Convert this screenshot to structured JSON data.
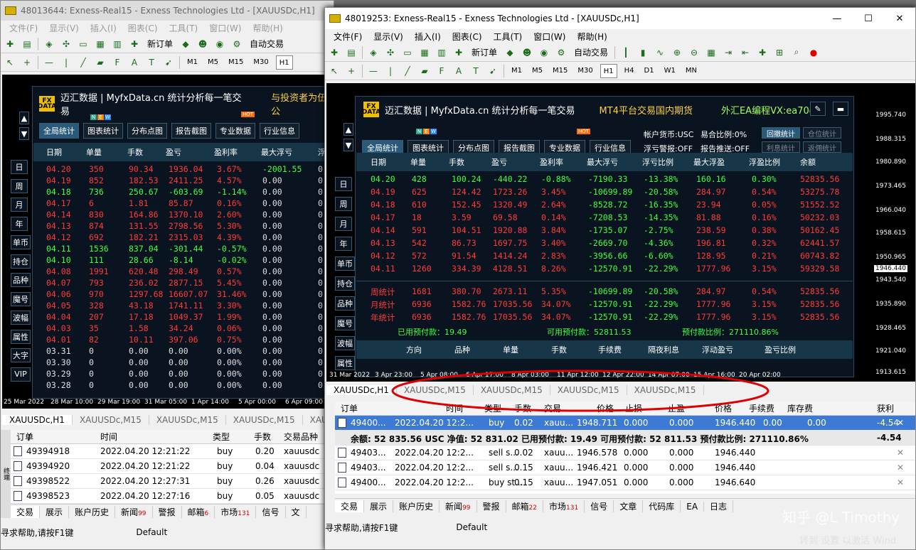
{
  "win1": {
    "title": "48013644: Exness-Real15 - Exness Technologies Ltd - [XAUUSDc,H1]",
    "menu": [
      "文件(F)",
      "显示(V)",
      "插入(I)",
      "图表(C)",
      "工具(T)",
      "窗口(W)",
      "帮助(H)"
    ],
    "new_order": "新订单",
    "auto": "自动交易",
    "tfs": [
      "M1",
      "M5",
      "M15",
      "M30",
      "H1"
    ],
    "brand": "迈汇数据 | MyfxData.cn  统计分析每一笔交易",
    "slogan": "与投资者为伍公",
    "buttons": [
      "全局统计",
      "图表统计",
      "分布点图",
      "报告截图",
      "专业数据",
      "行业信息"
    ],
    "headers": [
      "日期",
      "单量",
      "手数",
      "盈亏",
      "盈利率",
      "最大浮亏",
      "浮"
    ],
    "side": [
      "日",
      "周",
      "月",
      "年",
      "单币",
      "持仓",
      "品种",
      "魔号",
      "波幅",
      "属性",
      "大字",
      "VIP"
    ],
    "rows": [
      [
        "04.20",
        "350",
        "90.34",
        "1936.04",
        "3.67%",
        "-2001.55",
        "0.00",
        "r"
      ],
      [
        "04.19",
        "852",
        "182.53",
        "2411.25",
        "4.57%",
        "0.00",
        "0.00",
        "r"
      ],
      [
        "04.18",
        "736",
        "250.67",
        "-603.69",
        "-1.14%",
        "0.00",
        "0.00",
        "g"
      ],
      [
        "04.17",
        "6",
        "1.81",
        "85.87",
        "0.16%",
        "0.00",
        "0.00",
        "r"
      ],
      [
        "04.14",
        "830",
        "164.86",
        "1370.10",
        "2.60%",
        "0.00",
        "0.00",
        "r"
      ],
      [
        "04.13",
        "874",
        "131.55",
        "2798.56",
        "5.30%",
        "0.00",
        "0.00",
        "r"
      ],
      [
        "04.12",
        "692",
        "182.21",
        "2315.03",
        "4.39%",
        "0.00",
        "0.00",
        "r"
      ],
      [
        "04.11",
        "1536",
        "837.04",
        "-301.44",
        "-0.57%",
        "0.00",
        "0.00",
        "g"
      ],
      [
        "04.10",
        "111",
        "28.66",
        "-8.14",
        "-0.02%",
        "0.00",
        "0.00",
        "g"
      ],
      [
        "04.08",
        "1991",
        "620.48",
        "298.49",
        "0.57%",
        "0.00",
        "0.00",
        "r"
      ],
      [
        "04.07",
        "793",
        "236.02",
        "2877.15",
        "5.45%",
        "0.00",
        "0.00",
        "r"
      ],
      [
        "04.06",
        "970",
        "1297.68",
        "16607.07",
        "31.46%",
        "0.00",
        "0.00",
        "r"
      ],
      [
        "04.05",
        "328",
        "43.18",
        "1741.11",
        "3.30%",
        "0.00",
        "0.00",
        "r"
      ],
      [
        "04.04",
        "207",
        "17.18",
        "1049.37",
        "1.99%",
        "0.00",
        "0.00",
        "r"
      ],
      [
        "04.03",
        "35",
        "1.58",
        "34.24",
        "0.06%",
        "0.00",
        "0.00",
        "r"
      ],
      [
        "04.01",
        "82",
        "10.11",
        "397.06",
        "0.75%",
        "0.00",
        "0.00",
        "r"
      ],
      [
        "03.31",
        "0",
        "0.00",
        "0.00",
        "0.00%",
        "0.00",
        "0.00",
        "w"
      ],
      [
        "03.30",
        "0",
        "0.00",
        "0.00",
        "0.00%",
        "0.00",
        "0.00",
        "w"
      ],
      [
        "03.29",
        "0",
        "0.00",
        "0.00",
        "0.00%",
        "0.00",
        "0.00",
        "w"
      ],
      [
        "03.28",
        "0",
        "0.00",
        "0.00",
        "0.00%",
        "0.00",
        "0.00",
        "w"
      ]
    ],
    "xaxis": [
      "25 Mar 2022",
      "28 Mar 10:00",
      "29 Mar 19:00",
      "31 Mar 05:00",
      "1 Apr 14:00",
      "5 Apr 00:00",
      "6 Apr 09:00"
    ],
    "tabs": [
      "XAUUSDc,H1",
      "XAUUSDc,M15",
      "XAUUSDc,M15",
      "XAUUSDc,M15",
      "XAUU"
    ],
    "term_headers": [
      "订单",
      "/",
      "时间",
      "类型",
      "手数",
      "交易品种"
    ],
    "trades": [
      [
        "49394918",
        "2022.04.20 12:21:22",
        "buy",
        "0.20",
        "xauusdc"
      ],
      [
        "49394920",
        "2022.04.20 12:21:22",
        "buy",
        "0.04",
        "xauusdc"
      ],
      [
        "49398522",
        "2022.04.20 12:27:31",
        "buy",
        "0.26",
        "xauusdc"
      ],
      [
        "49398523",
        "2022.04.20 12:27:16",
        "buy",
        "0.05",
        "xauusdc"
      ]
    ],
    "btabs": [
      [
        "交易",
        ""
      ],
      [
        "展示",
        ""
      ],
      [
        "账户历史",
        ""
      ],
      [
        "新闻",
        "99"
      ],
      [
        "警报",
        ""
      ],
      [
        "邮箱",
        "6"
      ],
      [
        "市场",
        "131"
      ],
      [
        "信号",
        ""
      ],
      [
        "文",
        ""
      ]
    ],
    "status": "寻求帮助,请按F1键",
    "status2": "Default",
    "side_label": "终端"
  },
  "win2": {
    "title": "48019253: Exness-Real15 - Exness Technologies Ltd - [XAUUSDc,H1]",
    "menu": [
      "文件(F)",
      "显示(V)",
      "插入(I)",
      "图表(C)",
      "工具(T)",
      "窗口(W)",
      "帮助(H)"
    ],
    "new_order": "新订单",
    "auto": "自动交易",
    "tfs": [
      "M1",
      "M5",
      "M15",
      "M30",
      "H1",
      "H4",
      "D1",
      "W1",
      "MN"
    ],
    "brand": "迈汇数据 | MyfxData.cn  统计分析每一笔交易",
    "mt4": "MT4平台交易国内期货",
    "ea": "外汇EA编程VX:ea70ea",
    "buttons": [
      "全局统计",
      "图表统计",
      "分布点图",
      "报告截图",
      "专业数据",
      "行业信息"
    ],
    "hot": "HOT",
    "new_badge": [
      "N",
      "E",
      "W"
    ],
    "info": [
      "帐户货币:USC",
      "易合比例:0%",
      "浮亏警报:OFF",
      "报告推送:OFF"
    ],
    "right_btns": [
      "回撤统计",
      "仓位统计",
      "利息统计",
      "返佣统计"
    ],
    "headers": [
      "日期",
      "单量",
      "手数",
      "盈亏",
      "盈利率",
      "最大浮亏",
      "浮亏比例",
      "最大浮盈",
      "浮盈比例",
      "余额"
    ],
    "side": [
      "日",
      "周",
      "月",
      "年",
      "单币",
      "持仓",
      "品种",
      "魔号",
      "波幅",
      "属性"
    ],
    "rows": [
      [
        "04.20",
        "428",
        "100.24",
        "-440.22",
        "-0.88%",
        "-7190.33",
        "-13.38%",
        "160.16",
        "0.30%",
        "52835.56",
        "g"
      ],
      [
        "04.19",
        "625",
        "124.42",
        "1723.26",
        "3.45%",
        "-10699.89",
        "-20.58%",
        "284.97",
        "0.54%",
        "53275.78",
        "r"
      ],
      [
        "04.18",
        "610",
        "152.45",
        "1320.49",
        "2.64%",
        "-8528.72",
        "-16.35%",
        "23.94",
        "0.05%",
        "51552.52",
        "r"
      ],
      [
        "04.17",
        "18",
        "3.59",
        "69.58",
        "0.14%",
        "-7208.53",
        "-14.35%",
        "81.88",
        "0.16%",
        "50232.03",
        "r"
      ],
      [
        "04.14",
        "591",
        "104.51",
        "1920.88",
        "3.84%",
        "-1735.07",
        "-2.75%",
        "238.59",
        "0.38%",
        "50162.45",
        "r"
      ],
      [
        "04.13",
        "542",
        "86.73",
        "1697.75",
        "3.40%",
        "-2669.70",
        "-4.36%",
        "196.81",
        "0.32%",
        "62441.57",
        "r"
      ],
      [
        "04.12",
        "572",
        "91.54",
        "1414.24",
        "2.83%",
        "-3956.66",
        "-6.60%",
        "128.95",
        "0.21%",
        "60743.82",
        "r"
      ],
      [
        "04.11",
        "1260",
        "334.39",
        "4128.51",
        "8.26%",
        "-12570.91",
        "-22.29%",
        "1777.96",
        "3.15%",
        "59329.58",
        "r"
      ]
    ],
    "sums": [
      [
        "周统计",
        "1681",
        "380.70",
        "2673.11",
        "5.35%",
        "-10699.89",
        "-20.58%",
        "284.97",
        "0.54%",
        "52835.56"
      ],
      [
        "月统计",
        "6936",
        "1582.76",
        "17035.56",
        "34.07%",
        "-12570.91",
        "-22.29%",
        "1777.96",
        "3.15%",
        "52835.56"
      ],
      [
        "年统计",
        "6936",
        "1582.76",
        "17035.56",
        "34.07%",
        "-12570.91",
        "-22.29%",
        "1777.96",
        "3.15%",
        "52835.56"
      ]
    ],
    "footer": [
      "已用预付款：19.49",
      "可用预付款：52811.53",
      "预付款比例：271110.86%"
    ],
    "hdr2": [
      "方向",
      "品种",
      "单量",
      "手数",
      "手续费",
      "隔夜利息",
      "浮动盈亏",
      "盈亏比例"
    ],
    "yaxis": [
      "1995.740",
      "1988.315",
      "1980.890",
      "1973.465",
      "1966.040",
      "1958.615",
      "1950.965",
      "1946.440",
      "1943.540",
      "1935.890",
      "1928.465",
      "1921.040",
      "1913.615"
    ],
    "xaxis": [
      "31 Mar 2022",
      "3 Apr 23:00",
      "5 Apr 08:00",
      "6 Apr 17:00",
      "8 Apr 03:00",
      "11 Apr 12:00",
      "12 Apr 22:00",
      "14 Apr 07:00",
      "15 Apr 16:00",
      "20 Apr 02:00"
    ],
    "tabs": [
      "XAUUSDc,H1",
      "XAUUSDc,M15",
      "XAUUSDc,M15",
      "XAUUSDc,M15",
      "XAUUSDc,M15"
    ],
    "term_headers": [
      "订单",
      "时间",
      "类型",
      "手数",
      "交易",
      "价格",
      "止损",
      "止盈",
      "价格",
      "手续费",
      "库存费",
      "获利"
    ],
    "sel": [
      "49400...",
      "2022.04.20 12:2...",
      "buy",
      "0.02",
      "xauu...",
      "1948.711",
      "0.000",
      "0.000",
      "1946.440",
      "0.00",
      "0.00",
      "-4.54"
    ],
    "balance": "余额: 52 835.56 USC  净值: 52 831.02  已用预付款: 19.49  可用预付款: 52 811.53  预付款比例: 271110.86%",
    "balance_pl": "-4.54",
    "pend": [
      [
        "49403...",
        "2022.04.20 12:2...",
        "sell s...",
        "0.02",
        "xauu...",
        "1946.578",
        "0.000",
        "0.000",
        "1946.440"
      ],
      [
        "49403...",
        "2022.04.20 12:2...",
        "sell s...",
        "0.15",
        "xauu...",
        "1946.421",
        "0.000",
        "0.000",
        "1946.440"
      ],
      [
        "49400...",
        "2022.04.20 12:2...",
        "buy st...",
        "0.15",
        "xauu...",
        "1947.051",
        "0.000",
        "0.000",
        "1946.640"
      ]
    ],
    "btabs": [
      [
        "交易",
        ""
      ],
      [
        "展示",
        ""
      ],
      [
        "账户历史",
        ""
      ],
      [
        "新闻",
        "99"
      ],
      [
        "警报",
        ""
      ],
      [
        "邮箱",
        "22"
      ],
      [
        "市场",
        "131"
      ],
      [
        "信号",
        ""
      ],
      [
        "文章",
        ""
      ],
      [
        "代码库",
        ""
      ],
      [
        "EA",
        ""
      ],
      [
        "日志",
        ""
      ]
    ],
    "status": "寻求帮助,请按F1键",
    "status2": "Default"
  },
  "watermark": "知乎 @L Timothy",
  "activate": "转到 设置 以激活 Wind"
}
